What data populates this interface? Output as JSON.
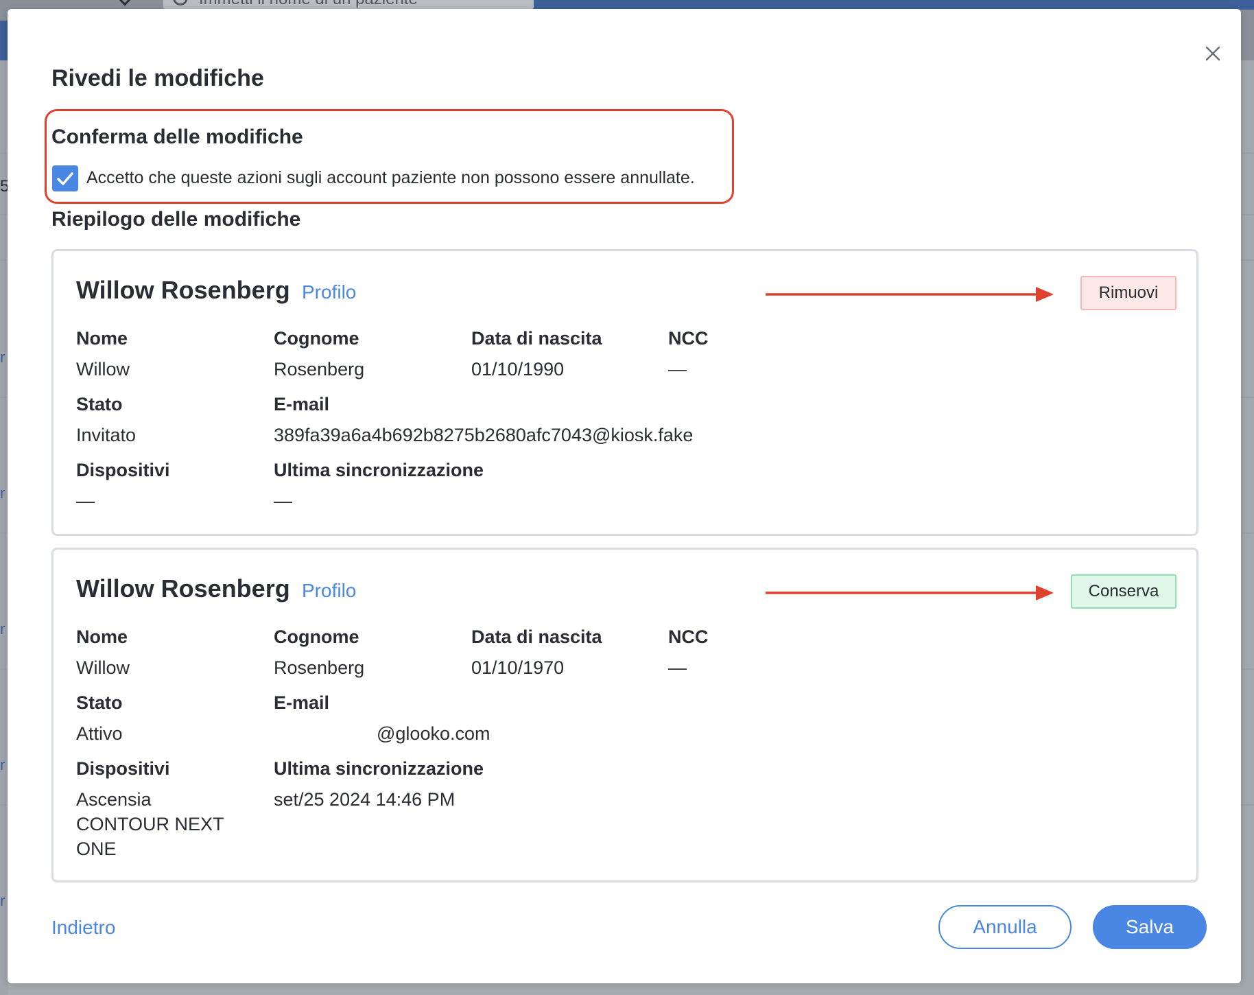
{
  "background": {
    "search_placeholder": "Immetti il nome di un paziente",
    "row_number_fragment": "5",
    "link_fragment": "r"
  },
  "modal": {
    "title": "Rivedi le modifiche",
    "close_icon": "close-icon",
    "confirm": {
      "title": "Conferma delle modifiche",
      "checkbox_checked": true,
      "checkbox_label": "Accetto che queste azioni sugli account paziente non possono essere annullate."
    },
    "summary_title": "Riepilogo delle modifiche",
    "labels": {
      "first_name": "Nome",
      "last_name": "Cognome",
      "dob": "Data di nascita",
      "ncc": "NCC",
      "status": "Stato",
      "email": "E-mail",
      "devices": "Dispositivi",
      "last_sync": "Ultima sincronizzazione"
    },
    "patients": [
      {
        "name": "Willow Rosenberg",
        "profile_link": "Profilo",
        "action_label": "Rimuovi",
        "action_type": "remove",
        "first_name": "Willow",
        "last_name": "Rosenberg",
        "dob": "01/10/1990",
        "ncc": "—",
        "status": "Invitato",
        "email": "389fa39a6a4b692b8275b2680afc7043@kiosk.fake",
        "devices": "—",
        "last_sync": "—"
      },
      {
        "name": "Willow Rosenberg",
        "profile_link": "Profilo",
        "action_label": "Conserva",
        "action_type": "keep",
        "first_name": "Willow",
        "last_name": "Rosenberg",
        "dob": "01/10/1970",
        "ncc": "—",
        "status": "Attivo",
        "email": "@glooko.com",
        "devices": "Ascensia CONTOUR NEXT ONE",
        "last_sync": "set/25 2024 14:46 PM"
      }
    ],
    "footer": {
      "back_label": "Indietro",
      "cancel_label": "Annulla",
      "save_label": "Salva"
    }
  },
  "colors": {
    "accent": "#4a86e3",
    "highlight": "#e0412f",
    "remove_bg": "#fde8e8",
    "keep_bg": "#e0f7e9"
  }
}
